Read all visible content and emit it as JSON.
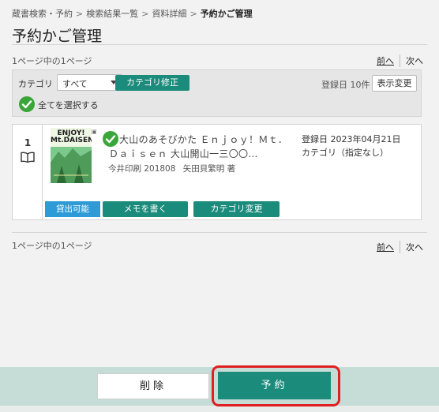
{
  "breadcrumb": {
    "items": [
      "蔵書検索・予約",
      "検索結果一覧",
      "資料詳細"
    ],
    "separator": ">",
    "current": "予約かご管理"
  },
  "page_title": "予約かご管理",
  "pager_top": {
    "info": "1ページ中の1ページ",
    "prev": "前へ",
    "next": "次へ"
  },
  "toolbar": {
    "category_label": "カテゴリ",
    "category_selected": "すべて",
    "category_edit_button": "カテゴリ修正",
    "sort_count": "登録日 10件",
    "display_change_button": "表示変更",
    "select_all_label": "全てを選択する"
  },
  "items": [
    {
      "number": "1",
      "cover_title_line1": "ENJOY!",
      "cover_title_line2": "Mt.DAISEN",
      "title_line1": "大山のあそびかた Ｅｎｊｏｙ！Ｍｔ．",
      "title_line2": "Ｄａｉｓｅｎ 大山開山一三〇〇…",
      "publisher": "今井印刷 201808",
      "author": "矢田貝繁明 著",
      "registered": "登録日 2023年04月21日",
      "category": "カテゴリ（指定なし）",
      "status": "貸出可能",
      "memo_button": "メモを書く",
      "category_change_button": "カテゴリ変更"
    }
  ],
  "pager_bottom": {
    "info": "1ページ中の1ページ",
    "prev": "前へ",
    "next": "次へ"
  },
  "footer": {
    "delete_button": "削除",
    "reserve_button": "予約"
  },
  "colors": {
    "teal": "#1b8b7b",
    "status_blue": "#2e9bd6",
    "check_green": "#3aa63a",
    "highlight_red": "#e02020",
    "footer_bg": "#c6dcd6"
  },
  "icons": {
    "selected": "check-circle-icon",
    "item_type": "book-icon",
    "dropdown": "chevron-down-icon"
  }
}
